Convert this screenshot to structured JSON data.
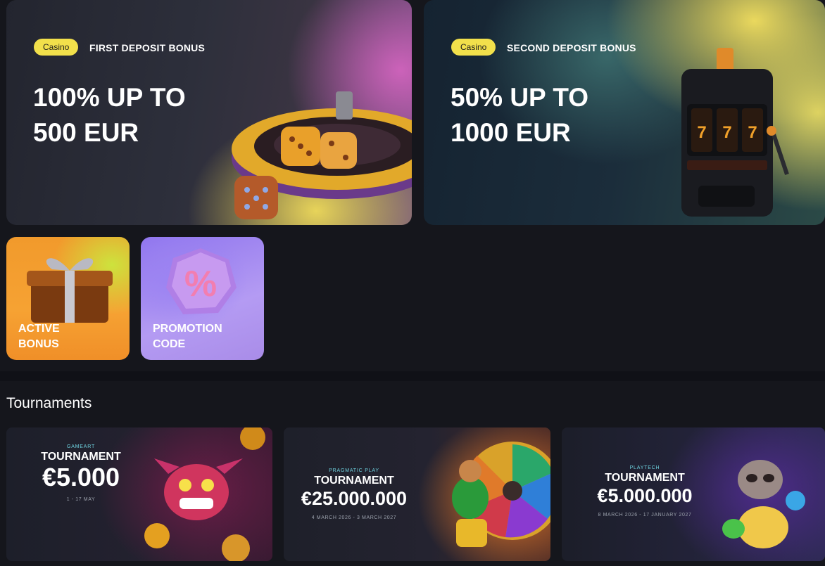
{
  "bonuses": [
    {
      "badge": "Casino",
      "type": "FIRST DEPOSIT BONUS",
      "amount_line1": "100% UP TO",
      "amount_line2": "500 EUR"
    },
    {
      "badge": "Casino",
      "type": "SECOND DEPOSIT BONUS",
      "amount_line1": "50% UP TO",
      "amount_line2": "1000 EUR"
    }
  ],
  "tiles": [
    {
      "line1": "ACTIVE",
      "line2": "BONUS"
    },
    {
      "line1": "PROMOTION",
      "line2": "CODE"
    }
  ],
  "tournaments_section": {
    "title": "Tournaments"
  },
  "tournaments": [
    {
      "provider": "GAMEART",
      "label": "TOURNAMENT",
      "prize": "€5.000",
      "dates": "1 - 17 MAY"
    },
    {
      "provider": "PRAGMATIC PLAY",
      "label": "TOURNAMENT",
      "prize": "€25.000.000",
      "dates": "4 MARCH 2026 - 3 MARCH 2027"
    },
    {
      "provider": "PLAYTECH",
      "label": "TOURNAMENT",
      "prize": "€5.000.000",
      "dates": "8 MARCH 2026 - 17 JANUARY 2027"
    }
  ],
  "colors": {
    "background": "#15161c",
    "badge": "#f2e04b",
    "provider_text": "#6fd3e0"
  },
  "icons": {
    "card1_art": "roulette-dice-icon",
    "card2_art": "slot-machine-icon",
    "tile1_art": "gift-box-icon",
    "tile2_art": "percent-badge-icon"
  }
}
